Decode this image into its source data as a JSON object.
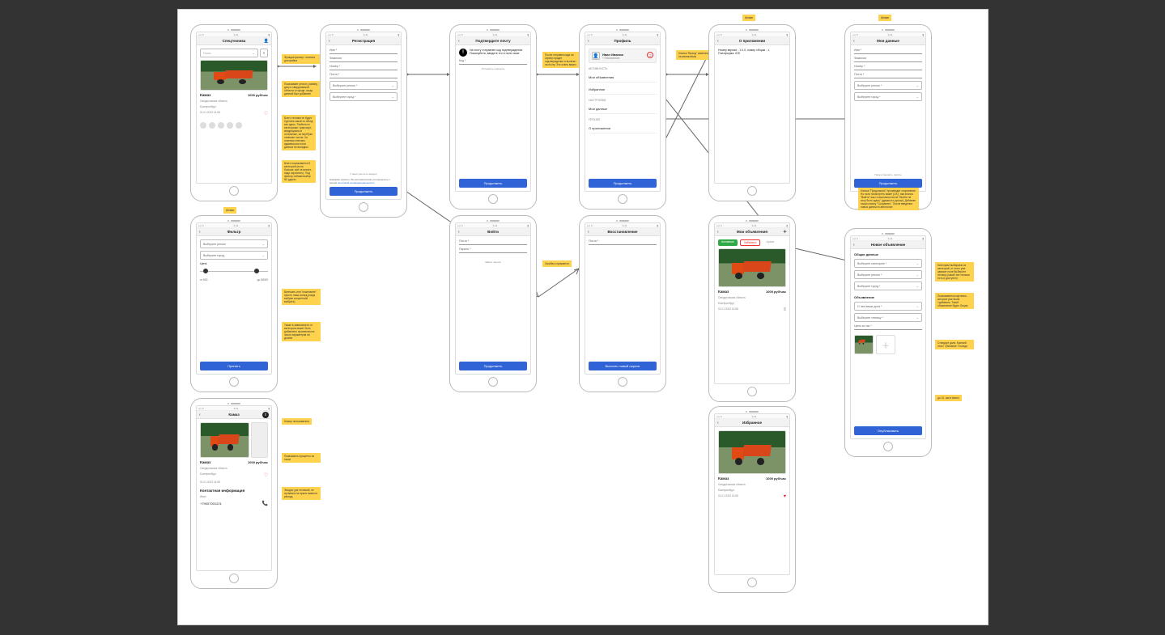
{
  "status": {
    "time": "9:41",
    "l": "•••• ≡",
    "r": "▮"
  },
  "feed": {
    "title": "Спецтехника",
    "search_ph": "Поиск",
    "card": {
      "name": "Камаз",
      "price": "1000 руб/час",
      "region": "Свердловская область",
      "city": "Екатеринбург",
      "date": "01.01.2023  14:58"
    }
  },
  "reg": {
    "title": "Регистрация",
    "name": "Имя *",
    "surname": "Фамилия",
    "phone": "Номер *",
    "email": "Почта *",
    "region": "Выберите регион *",
    "city": "Выберите город *",
    "have_acc": "У меня уже есть аккаунт",
    "policy_pre": "Нажимая принять, Вы автоматически соглашаетесь с нашей ",
    "policy_link": "политикой конфиденциальности",
    "btn": "Продолжить"
  },
  "confirm": {
    "title": "Подтвердите почту",
    "msg": "На почту отправлен код подтверждения. Пожалуйста, введите его в поле ниже",
    "code": "Код *",
    "resend": "Отправить повторно",
    "btn": "Продолжить"
  },
  "profile": {
    "title": "Профиль",
    "name": "Иван Иванов",
    "phone": "+79#########",
    "activity": "АКТИВНОСТЬ",
    "my_ads": "Мои объявления",
    "favs": "Избранное",
    "settings": "НАСТРОЙКИ",
    "my_data": "Мои данные",
    "other": "ПРОЧЕЕ",
    "about": "О приложении",
    "btn": "Продолжить"
  },
  "about": {
    "title": "О приложении",
    "text": "Номер версии - 1.0.0, номер сборки - 1. Платформа: iOS"
  },
  "mydata": {
    "title": "Мои данные",
    "name": "Имя *",
    "surname": "Фамилия",
    "phone": "Номер *",
    "email": "Почта *",
    "region": "Выберите регион *",
    "city": "Выберите город *",
    "rec": "Переустановить пароль",
    "btn": "Продолжить"
  },
  "filter": {
    "title": "Фильтр",
    "region": "Выберите регион",
    "city": "Выберите город",
    "price": "Цена",
    "from": "от   500",
    "to": "до   50000",
    "btn": "Принять"
  },
  "login": {
    "title": "Войти",
    "email": "Почта *",
    "pass": "Пароль *",
    "forgot": "Забыл пароль",
    "btn": "Продолжить"
  },
  "recover": {
    "title": "Восстановление",
    "email": "Почта *",
    "btn": "Выслать новый пароль"
  },
  "myads": {
    "title": "Мои объявления",
    "tab_active": "Активные",
    "tab_rej": "Забанено",
    "tab_arch": "Архив"
  },
  "favs": {
    "title": "Избранное"
  },
  "newad": {
    "title": "Новое объявление",
    "sec1": "Общие данные",
    "cat": "Выберите категорию *",
    "region": "Выберите регион *",
    "city": "Выберите город *",
    "sec2": "Объявление",
    "about": "О чем ваша доля *",
    "tech": "Выберите технику *",
    "price": "Цена за час *",
    "btn": "Опубликовать"
  },
  "detail": {
    "title": "Камаз",
    "contact": "Контактная информация",
    "owner": "Иван",
    "phone": "+79007001221"
  },
  "notes": {
    "n_feed_filter": "Функция фильтр: полезна для файна",
    "n_feed_data": "Показывает регион, размер, дату в свердловской области и городе, когда данный был добавлен",
    "n_feed_long": "Всего техники не будет. Сделать какой-то обход как здесь. Разбить по категориям: транспорт, квадроциклы и остальные, за ноутбуки отвечают числа. За платежи отвечать админка или если данные не валидны",
    "n_feed_dots": "Всего показывается 5 категорий (если больше, всё не влезет, надо скроллить). Под фильтр-табами выбор N0 других",
    "n_confirm": "После отправки кода на сервер придет подтверждение и вылезет на почту. Это очень важно",
    "n_logout": "Кнопка \"Выход\" заменена на автомобиль",
    "n_about_t": "Штамп",
    "n_mydata_t": "Штамп",
    "n_mydata_long": "Кнопка \"Продолжить\" производит сохранение. Но если посмотреть макет (UX), там кнопка \"Выйти\" как-то вылезала после \"Выйти не хочу быть здесь\" (думаю по-русски). Добавлю такую кнопку \"Сохранить\". После введения новых данных в автологин",
    "n_filter_t": "Штамп",
    "n_filter_cat": "Включать или \"пожелание\" просто лишь колид (когда выбран конкретный выбрать)",
    "n_filter_dep": "Также в зависимости от категории может быть добавлено произвольное число параметров на уровне",
    "n_login": "Ошибка отражается",
    "n_detail_1": "Номер пользователя",
    "n_detail_2": "Показывать проценты за такое",
    "n_detail_3": "Эмодзи ура техникой, не путаемся на нужно вывести рекорд",
    "n_newad_1": "Категории выбираем из категорий, от этого уже зависит поле Выберите технику (какой тип техники есть и доступен)",
    "n_newad_2": "Показываются картинки - которые уже были +добавить. Такой объявление будто Опции",
    "n_newad_3": "Стандарт доля. Краткий текст. Описание +соседи",
    "n_newad_4": "до 10, как в Авито"
  }
}
